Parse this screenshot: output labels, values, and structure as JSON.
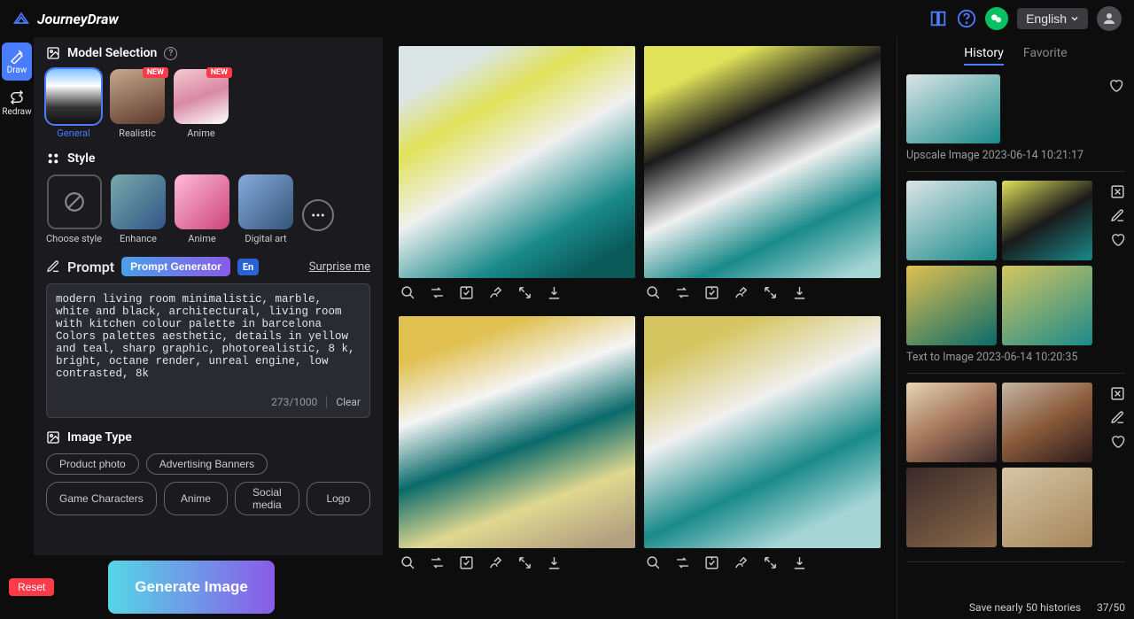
{
  "header": {
    "logo": "JourneyDraw",
    "language": "English"
  },
  "rail": {
    "draw": "Draw",
    "redraw": "Redraw"
  },
  "model_selection": {
    "title": "Model Selection",
    "models": [
      {
        "label": "General",
        "new": false,
        "active": true
      },
      {
        "label": "Realistic",
        "new": true,
        "active": false
      },
      {
        "label": "Anime",
        "new": true,
        "active": false
      }
    ]
  },
  "style": {
    "title": "Style",
    "items": [
      {
        "label": "Choose style"
      },
      {
        "label": "Enhance"
      },
      {
        "label": "Anime"
      },
      {
        "label": "Digital art"
      }
    ]
  },
  "prompt": {
    "title": "Prompt",
    "generator_btn": "Prompt Generator",
    "lang_badge": "En",
    "surprise": "Surprise me",
    "text": "modern living room minimalistic, marble, white and black, architectural, living room with kitchen colour palette in barcelona Colors palettes aesthetic, details in yellow and teal, sharp graphic, photorealistic, 8 k, bright, octane render, unreal engine, low contrasted, 8k",
    "counter": "273/1000",
    "clear": "Clear"
  },
  "image_type": {
    "title": "Image Type",
    "chips": [
      "Product photo",
      "Advertising Banners",
      "Game Characters",
      "Anime",
      "Social media",
      "Logo"
    ]
  },
  "bottom": {
    "reset": "Reset",
    "generate": "Generate Image"
  },
  "right": {
    "tabs": {
      "history": "History",
      "favorite": "Favorite"
    },
    "items": [
      {
        "caption": "Upscale Image 2023-06-14 10:21:17",
        "single": true
      },
      {
        "caption": "Text to Image 2023-06-14 10:20:35",
        "single": false
      }
    ],
    "status_text": "Save nearly 50 histories",
    "status_count": "37/50"
  },
  "badges": {
    "new": "NEW"
  }
}
